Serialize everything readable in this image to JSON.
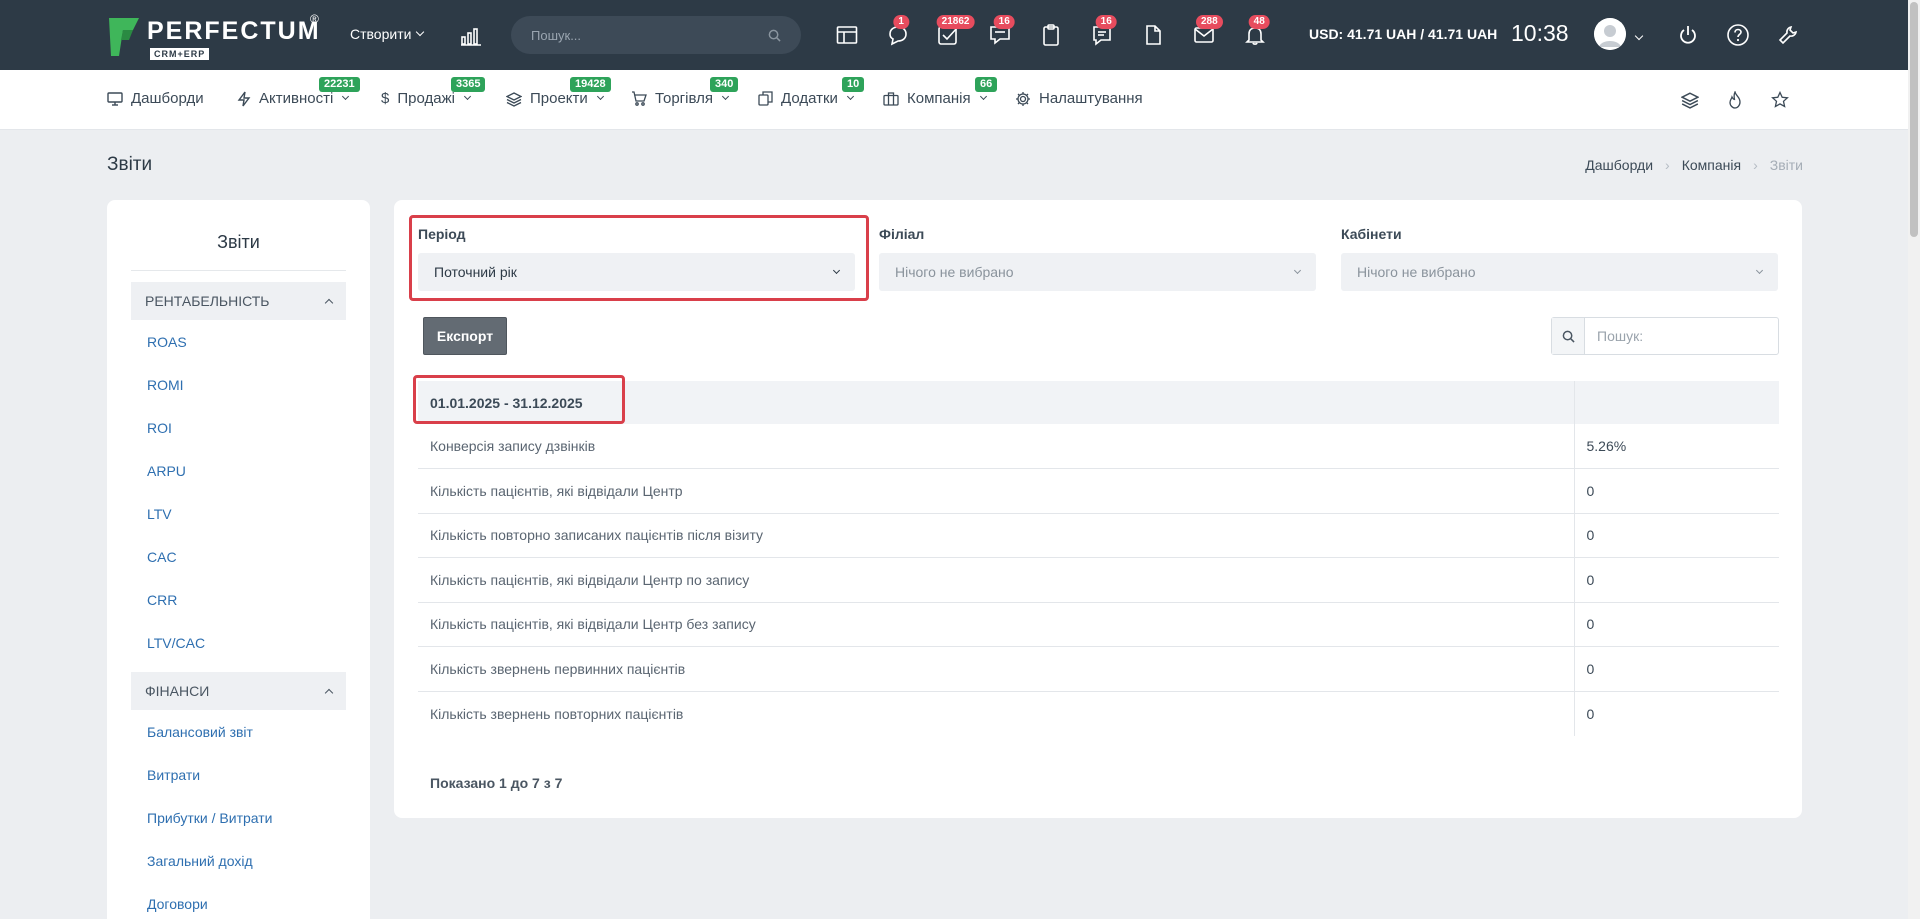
{
  "brand": {
    "name": "PERFECTUM",
    "registered": "®",
    "subtitle": "CRM+ERP"
  },
  "topbar": {
    "create_label": "Створити",
    "search_placeholder": "Пошук...",
    "badges": {
      "chat": "1",
      "tasks": "21862",
      "messages": "16",
      "notes": "16",
      "mail": "288",
      "notifications": "48"
    },
    "currency": "USD: 41.71 UAH / 41.71 UAH",
    "time": "10:38"
  },
  "nav": {
    "items": [
      {
        "label": "Дашборди",
        "badge": ""
      },
      {
        "label": "Активності",
        "badge": "22231"
      },
      {
        "label": "Продажі",
        "badge": "3365"
      },
      {
        "label": "Проекти",
        "badge": "19428"
      },
      {
        "label": "Торгівля",
        "badge": "340"
      },
      {
        "label": "Додатки",
        "badge": "10"
      },
      {
        "label": "Компанія",
        "badge": "66"
      },
      {
        "label": "Налаштування",
        "badge": ""
      }
    ]
  },
  "page": {
    "title": "Звіти",
    "breadcrumb": [
      "Дашборди",
      "Компанія",
      "Звіти"
    ]
  },
  "sidebar": {
    "title": "Звіти",
    "group1": {
      "label": "РЕНТАБЕЛЬНІСТЬ",
      "items": [
        "ROAS",
        "ROMI",
        "ROI",
        "ARPU",
        "LTV",
        "CAC",
        "CRR",
        "LTV/CAC"
      ]
    },
    "group2": {
      "label": "ФІНАНСИ",
      "items": [
        "Балансовий звіт",
        "Витрати",
        "Прибутки / Витрати",
        "Загальний дохід",
        "Договори"
      ]
    }
  },
  "filters": {
    "period": {
      "label": "Період",
      "value": "Поточний рік"
    },
    "branch": {
      "label": "Філіал",
      "value": "Нічого не вибрано"
    },
    "rooms": {
      "label": "Кабінети",
      "value": "Нічого не вибрано"
    }
  },
  "table": {
    "export_label": "Експорт",
    "search_placeholder": "Пошук:",
    "header": "01.01.2025 - 31.12.2025",
    "rows": [
      {
        "name": "Конверсія запису дзвінків",
        "value": "5.26%"
      },
      {
        "name": "Кількість пацієнтів, які відвідали Центр",
        "value": "0"
      },
      {
        "name": "Кількість повторно записаних пацієнтів після візиту",
        "value": "0"
      },
      {
        "name": "Кількість пацієнтів, які відвідали Центр по запису",
        "value": "0"
      },
      {
        "name": "Кількість пацієнтів, які відвідали Центр без запису",
        "value": "0"
      },
      {
        "name": "Кількість звернень первинних пацієнтів",
        "value": "0"
      },
      {
        "name": "Кількість звернень повторних пацієнтів",
        "value": "0"
      }
    ],
    "showing": "Показано 1 до 7 з 7"
  },
  "colors": {
    "topbar": "#2d3a46",
    "accent_green": "#2ea35a",
    "badge_red": "#e74c5e",
    "highlight": "#d93f4a",
    "link": "#2e6fb0"
  }
}
